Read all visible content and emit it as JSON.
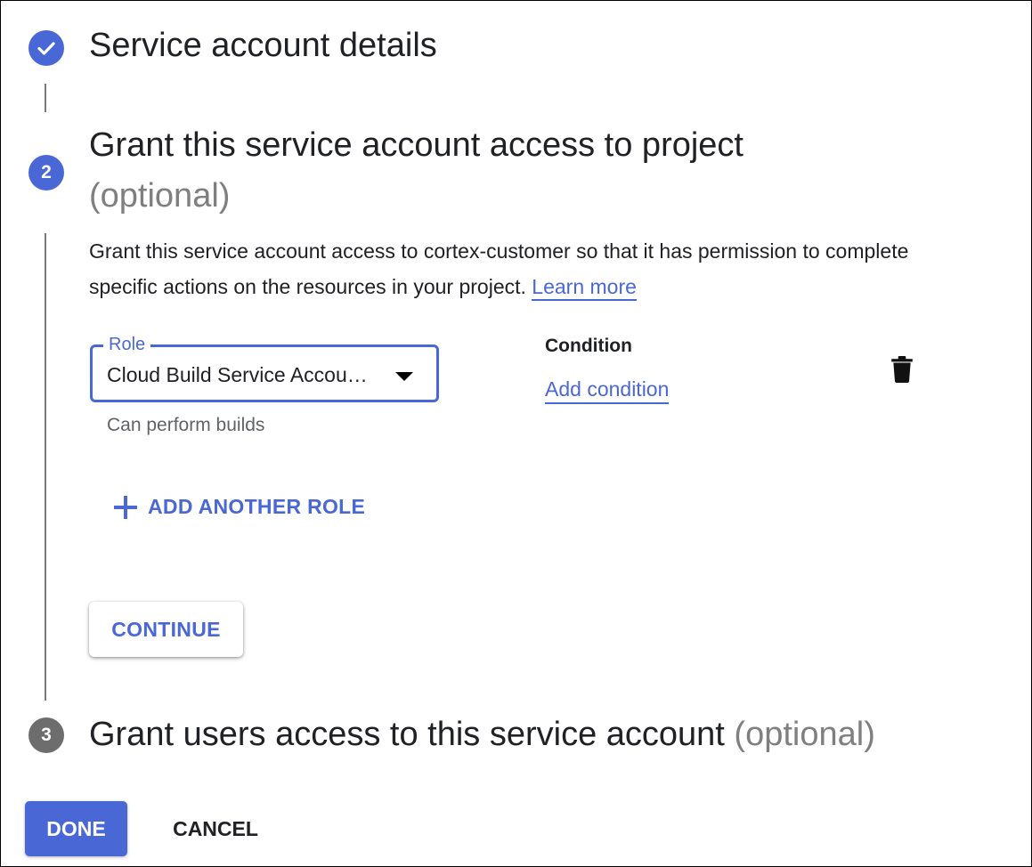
{
  "steps": {
    "step1": {
      "title": "Service account details",
      "state": "complete",
      "icon": "checkmark-icon"
    },
    "step2": {
      "number": "2",
      "title": "Grant this service account access to project",
      "optional": "(optional)",
      "description": "Grant this service account access to cortex-customer so that it has permission to complete specific actions on the resources in your project.",
      "learn_more": "Learn more"
    },
    "step3": {
      "number": "3",
      "title": "Grant users access to this service account",
      "optional": "(optional)"
    }
  },
  "role": {
    "label": "Role",
    "value": "Cloud Build Service Accou…",
    "helper": "Can perform builds"
  },
  "condition": {
    "label": "Condition",
    "add_link": "Add condition"
  },
  "actions": {
    "add_role": "ADD ANOTHER ROLE",
    "continue": "CONTINUE",
    "done": "DONE",
    "cancel": "CANCEL"
  },
  "colors": {
    "accent": "#4a67d6",
    "step_inactive": "#6d6d6d",
    "optional_text": "#7f7f7f"
  }
}
